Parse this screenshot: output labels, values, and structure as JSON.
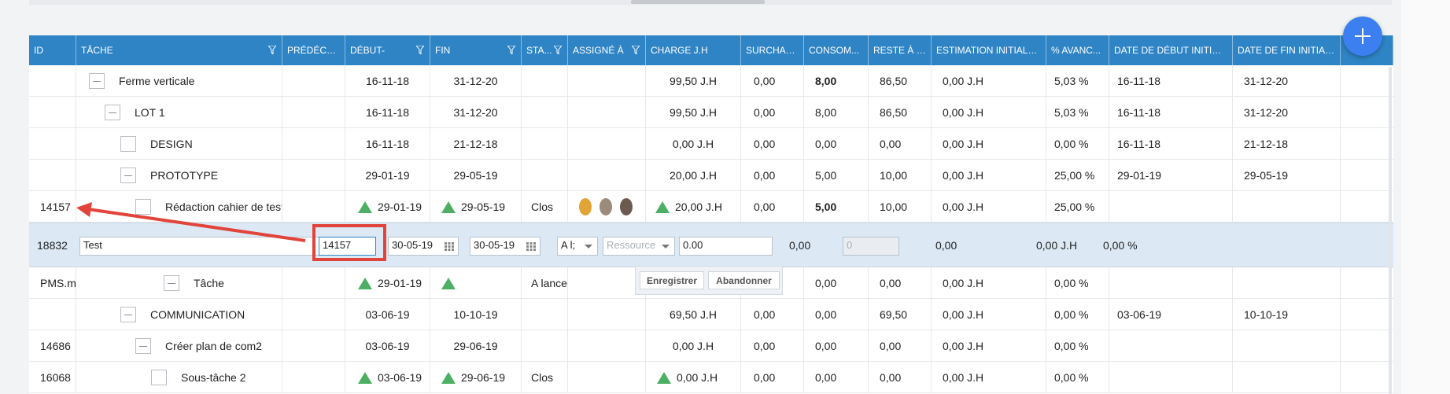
{
  "columns": [
    {
      "label": "ID",
      "filter": false
    },
    {
      "label": "TÂCHE",
      "filter": true
    },
    {
      "label": "PRÉDÉCES...",
      "filter": false
    },
    {
      "label": "DÉBUT-",
      "filter": true
    },
    {
      "label": "FIN",
      "filter": true
    },
    {
      "label": "STA...",
      "filter": true
    },
    {
      "label": "ASSIGNÉ À",
      "filter": true
    },
    {
      "label": "CHARGE J.H",
      "filter": false
    },
    {
      "label": "SURCHAR...",
      "filter": false
    },
    {
      "label": "CONSOM...",
      "filter": false
    },
    {
      "label": "RESTE À F...",
      "filter": false
    },
    {
      "label": "ESTIMATION INITIALE ...",
      "filter": false
    },
    {
      "label": "% AVANC...",
      "filter": false
    },
    {
      "label": "DATE DE DÉBUT INITIALE",
      "filter": false
    },
    {
      "label": "DATE DE FIN INITIALE",
      "filter": false
    }
  ],
  "rows": [
    {
      "id": "",
      "task": "Ferme verticale",
      "start": "16-11-18",
      "end": "31-12-20",
      "status": "",
      "charge": "99,50 J.H",
      "surcharge": "0,00",
      "consom": "8,00",
      "reste": "86,50",
      "estim": "0,00 J.H",
      "avanc": "5,03 %",
      "dstart": "16-11-18",
      "dend": "31-12-20"
    },
    {
      "id": "",
      "task": "LOT 1",
      "start": "16-11-18",
      "end": "31-12-20",
      "status": "",
      "charge": "99,50 J.H",
      "surcharge": "0,00",
      "consom": "8,00",
      "reste": "86,50",
      "estim": "0,00 J.H",
      "avanc": "5,03 %",
      "dstart": "16-11-18",
      "dend": "31-12-20"
    },
    {
      "id": "",
      "task": "DESIGN",
      "start": "16-11-18",
      "end": "21-12-18",
      "status": "",
      "charge": "0,00 J.H",
      "surcharge": "0,00",
      "consom": "0,00",
      "reste": "0,00",
      "estim": "0,00 J.H",
      "avanc": "0,00 %",
      "dstart": "16-11-18",
      "dend": "21-12-18"
    },
    {
      "id": "",
      "task": "PROTOTYPE",
      "start": "29-01-19",
      "end": "29-05-19",
      "status": "",
      "charge": "20,00 J.H",
      "surcharge": "0,00",
      "consom": "5,00",
      "reste": "10,00",
      "estim": "0,00 J.H",
      "avanc": "25,00 %",
      "dstart": "29-01-19",
      "dend": "29-05-19"
    },
    {
      "id": "14157",
      "task": "Rédaction cahier de tests",
      "start": "29-01-19",
      "end": "29-05-19",
      "status": "Clos",
      "charge": "20,00 J.H",
      "surcharge": "0,00",
      "consom": "5,00",
      "reste": "10,00",
      "estim": "0,00 J.H",
      "avanc": "25,00 %",
      "dstart": "",
      "dend": ""
    },
    {
      "id": "PMS.m",
      "task": "Tâche",
      "start": "29-01-19",
      "end": "",
      "status": "A lance",
      "charge": "",
      "surcharge": "0,00",
      "consom": "0,00",
      "reste": "0,00",
      "estim": "0,00 J.H",
      "avanc": "0,00 %",
      "dstart": "",
      "dend": ""
    },
    {
      "id": "",
      "task": "COMMUNICATION",
      "start": "03-06-19",
      "end": "10-10-19",
      "status": "",
      "charge": "69,50 J.H",
      "surcharge": "0,00",
      "consom": "0,00",
      "reste": "69,50",
      "estim": "0,00 J.H",
      "avanc": "0,00 %",
      "dstart": "03-06-19",
      "dend": "10-10-19"
    },
    {
      "id": "14686",
      "task": "Créer plan de com2",
      "start": "03-06-19",
      "end": "29-06-19",
      "status": "",
      "charge": "0,00 J.H",
      "surcharge": "0,00",
      "consom": "0,00",
      "reste": "0,00",
      "estim": "0,00 J.H",
      "avanc": "0,00 %",
      "dstart": "",
      "dend": ""
    },
    {
      "id": "16068",
      "task": "Sous-tâche 2",
      "start": "03-06-19",
      "end": "29-06-19",
      "status": "Clos",
      "charge": "0,00 J.H",
      "surcharge": "0,00",
      "consom": "0,00",
      "reste": "0,00",
      "estim": "0,00 J.H",
      "avanc": "0,00 %",
      "dstart": "",
      "dend": ""
    }
  ],
  "edit_row": {
    "id": "18832",
    "task_value": "Test",
    "pred_value": "14157",
    "start_value": "30-05-19",
    "end_value": "30-05-19",
    "status_value": "A l;",
    "resource_placeholder": "Ressource",
    "charge_value": "0.00",
    "surcharge": "0,00",
    "consom_placeholder": "0",
    "reste": "0,00",
    "estim": "0,00 J.H",
    "avanc": "0,00 %"
  },
  "popup": {
    "save_label": "Enregistrer",
    "cancel_label": "Abandonner"
  },
  "colors": {
    "header_bg": "#2f84c5",
    "edit_row_bg": "#dce9f5",
    "highlight": "#e1443a",
    "fab": "#3b7ff0",
    "status_up": "#4caf64"
  },
  "icons": {
    "fab": "plus-icon",
    "filter": "filter-icon",
    "calendar": "calendar-icon",
    "tree": "collapse-icon"
  }
}
